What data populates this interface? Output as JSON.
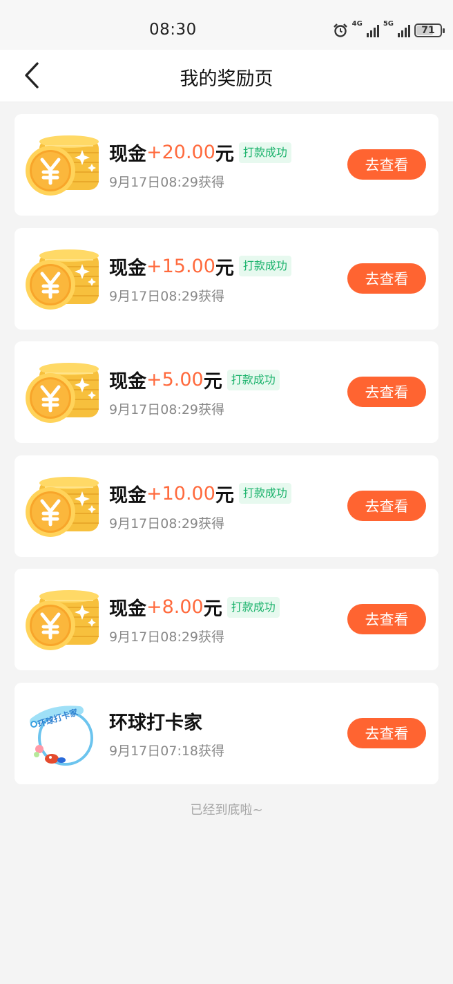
{
  "status_bar": {
    "time": "08:30",
    "network_1": "4G",
    "network_2": "5G",
    "battery": "71",
    "battery_level": 0.71,
    "icons": [
      "alarm-icon",
      "signal-4g-icon",
      "signal-5g-icon",
      "battery-icon"
    ]
  },
  "nav": {
    "title": "我的奖励页",
    "back_icon": "chevron-left-icon"
  },
  "rewards": [
    {
      "prefix": "现金",
      "amount": "+20.00",
      "suffix": "元",
      "badge": "打款成功",
      "time": "9月17日08:29获得",
      "button": "去查看",
      "icon": "coin-stack-icon"
    },
    {
      "prefix": "现金",
      "amount": "+15.00",
      "suffix": "元",
      "badge": "打款成功",
      "time": "9月17日08:29获得",
      "button": "去查看",
      "icon": "coin-stack-icon"
    },
    {
      "prefix": "现金",
      "amount": "+5.00",
      "suffix": "元",
      "badge": "打款成功",
      "time": "9月17日08:29获得",
      "button": "去查看",
      "icon": "coin-stack-icon"
    },
    {
      "prefix": "现金",
      "amount": "+10.00",
      "suffix": "元",
      "badge": "打款成功",
      "time": "9月17日08:29获得",
      "button": "去查看",
      "icon": "coin-stack-icon"
    },
    {
      "prefix": "现金",
      "amount": "+8.00",
      "suffix": "元",
      "badge": "打款成功",
      "time": "9月17日08:29获得",
      "button": "去查看",
      "icon": "coin-stack-icon"
    },
    {
      "prefix": "环球打卡家",
      "amount": "",
      "suffix": "",
      "badge": "",
      "time": "9月17日07:18获得",
      "button": "去查看",
      "icon": "avatar-frame-icon",
      "frame_text": "环球打卡家"
    }
  ],
  "footer": {
    "end_text": "已经到底啦~"
  },
  "colors": {
    "accent": "#ff6431",
    "amount": "#ff6a3d",
    "success": "#1ab26b",
    "background": "#f4f4f4"
  }
}
